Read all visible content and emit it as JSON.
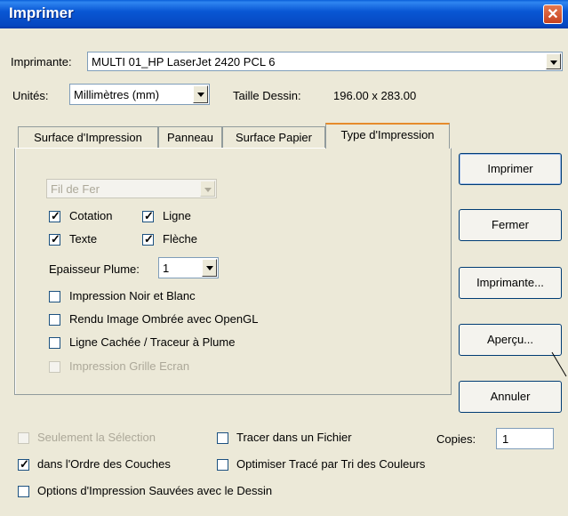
{
  "window": {
    "title": "Imprimer"
  },
  "printer": {
    "label": "Imprimante:",
    "value": "MULTI 01_HP LaserJet 2420 PCL 6"
  },
  "units": {
    "label": "Unités:",
    "value": "Millimètres (mm)"
  },
  "drawing_size": {
    "label": "Taille Dessin:",
    "value": "196.00 x 283.00"
  },
  "tabs": [
    {
      "label": "Surface d'Impression"
    },
    {
      "label": "Panneau"
    },
    {
      "label": "Surface Papier"
    },
    {
      "label": "Type d'Impression",
      "active": true
    }
  ],
  "print_type": {
    "mode_select": "Fil de Fer",
    "checks": {
      "cotation": {
        "label": "Cotation",
        "checked": true
      },
      "ligne": {
        "label": "Ligne",
        "checked": true
      },
      "texte": {
        "label": "Texte",
        "checked": true
      },
      "fleche": {
        "label": "Flèche",
        "checked": true
      }
    },
    "pen_thickness": {
      "label": "Epaisseur Plume:",
      "value": "1"
    },
    "options": [
      {
        "label": "Impression Noir et Blanc",
        "checked": false,
        "enabled": true
      },
      {
        "label": "Rendu Image Ombrée avec OpenGL",
        "checked": false,
        "enabled": true
      },
      {
        "label": "Ligne Cachée / Traceur à Plume",
        "checked": false,
        "enabled": true
      },
      {
        "label": "Impression Grille Ecran",
        "checked": false,
        "enabled": false
      }
    ]
  },
  "buttons": {
    "print": "Imprimer",
    "close": "Fermer",
    "printer": "Imprimante...",
    "preview": "Aperçu...",
    "cancel": "Annuler"
  },
  "bottom": {
    "selection_only": "Seulement la Sélection",
    "print_to_file": "Tracer dans un Fichier",
    "copies_label": "Copies:",
    "copies_value": "1",
    "layer_order": "dans l'Ordre des Couches",
    "optimize": "Optimiser Tracé par Tri des Couleurs",
    "save_options": "Options d'Impression Sauvées avec le Dessin"
  },
  "colors": {
    "titlebar": "#0a5fd8",
    "dialog_bg": "#ece9d8",
    "close": "#d8542d"
  }
}
